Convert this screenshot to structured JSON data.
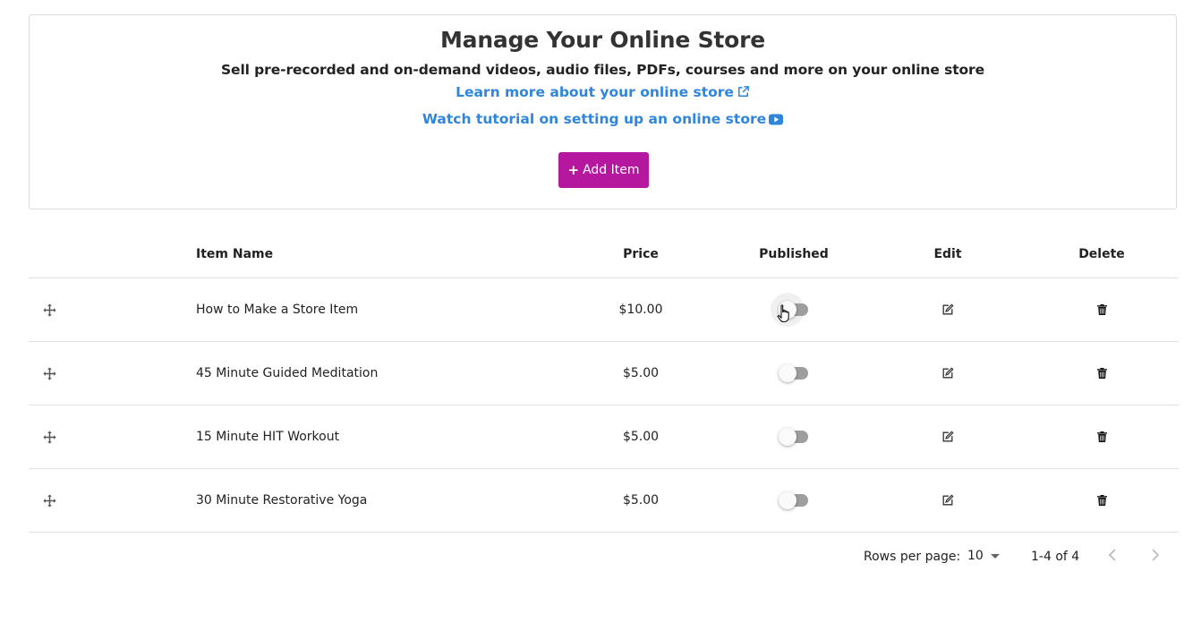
{
  "header": {
    "title": "Manage Your Online Store",
    "subtitle": "Sell pre-recorded and on-demand videos, audio files, PDFs, courses and more on your online store",
    "learn_more_link": "Learn more about your online store",
    "tutorial_link": "Watch tutorial on setting up an online store",
    "add_button_label": "Add Item",
    "accent_color": "#b5179e",
    "link_color": "#2f86dc"
  },
  "table": {
    "columns": [
      "Item Name",
      "Price",
      "Published",
      "Edit",
      "Delete"
    ],
    "rows": [
      {
        "name": "How to Make a Store Item",
        "price": "$10.00",
        "published": false
      },
      {
        "name": "45 Minute Guided Meditation",
        "price": "$5.00",
        "published": false
      },
      {
        "name": "15 Minute HIT Workout",
        "price": "$5.00",
        "published": false
      },
      {
        "name": "30 Minute Restorative Yoga",
        "price": "$5.00",
        "published": false
      }
    ]
  },
  "pagination": {
    "rows_per_page_label": "Rows per page:",
    "rows_per_page_value": "10",
    "range_text": "1-4 of 4"
  }
}
